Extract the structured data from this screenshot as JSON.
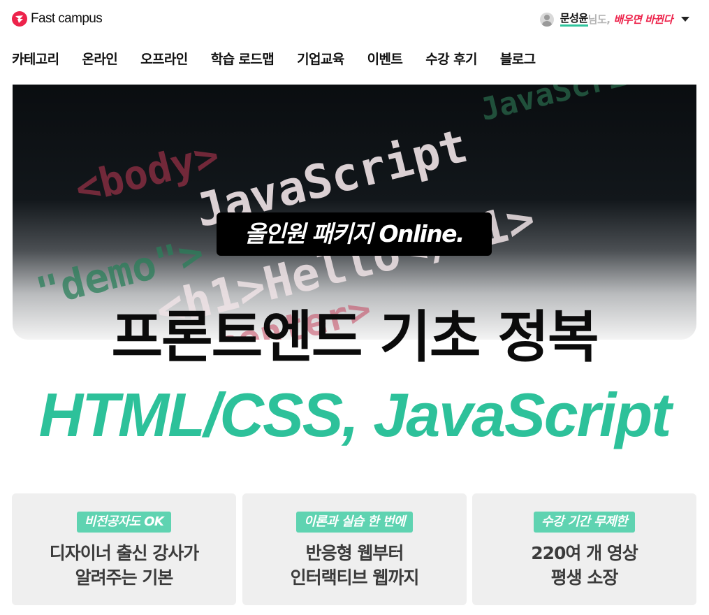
{
  "brand": {
    "logo_text": "Fast campus",
    "accent": "#ed234b"
  },
  "user": {
    "name": "문성윤",
    "suffix": " 님도,",
    "motto": "배우면 바뀐다"
  },
  "nav": [
    "카테고리",
    "온라인",
    "오프라인",
    "학습 로드맵",
    "기업교육",
    "이벤트",
    "수강 후기",
    "블로그"
  ],
  "hero": {
    "code_lines": [
      "<body>",
      "JavaScript",
      "\"demo\">",
      "JavaScri",
      "<h1>Hello</h1>",
      "center>"
    ],
    "badge": "올인원 패키지 Online.",
    "title": "프론트엔드 기초 정복",
    "subtitle": "HTML/CSS, JavaScript",
    "subtitle_color": "#2dc19a"
  },
  "cards": [
    {
      "tag": "비전공자도 OK",
      "line1": "디자이너 출신 강사가",
      "line2": "알려주는 기본"
    },
    {
      "tag": "이론과 실습 한 번에",
      "line1": "반응형 웹부터",
      "line2": "인터랙티브 웹까지"
    },
    {
      "tag": "수강 기간 무제한",
      "line1": "220여 개 영상",
      "line2": "평생 소장"
    }
  ]
}
